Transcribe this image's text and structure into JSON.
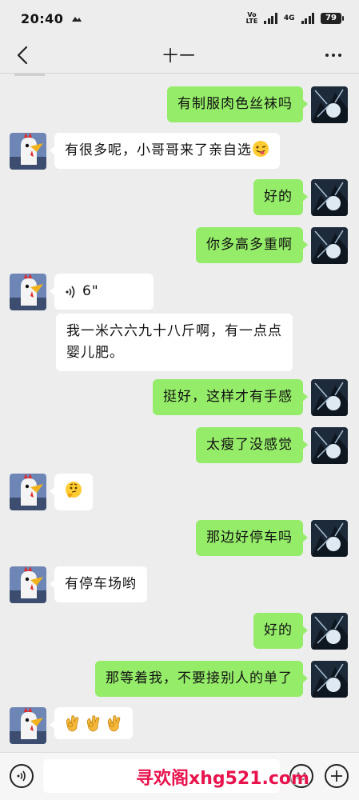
{
  "status_bar": {
    "time": "20:40",
    "net_top": "Vo",
    "net_bottom": "LTE",
    "net2": "4G",
    "battery": "79"
  },
  "nav": {
    "title": "十一",
    "back_icon": "chevron-left-icon",
    "more_icon": "more-dots-icon"
  },
  "messages": [
    {
      "side": "right",
      "text": "有制服肉色丝袜吗"
    },
    {
      "side": "left",
      "text": "有很多呢，小哥哥来了亲自选"
    },
    {
      "side": "right",
      "text": "好的"
    },
    {
      "side": "right",
      "text": "你多高多重啊"
    },
    {
      "side": "left",
      "type": "voice",
      "duration": "6\""
    },
    {
      "side": "left",
      "text_line1": "我一米六六九十八斤啊，有一点点",
      "text_line2": "婴儿肥。"
    },
    {
      "side": "right",
      "text": "挺好，这样才有手感"
    },
    {
      "side": "right",
      "text": "太瘦了没感觉"
    },
    {
      "side": "left",
      "type": "emoji",
      "emoji": "thinking-face"
    },
    {
      "side": "right",
      "text": "那边好停车吗"
    },
    {
      "side": "left",
      "text": "有停车场哟"
    },
    {
      "side": "right",
      "text": "好的"
    },
    {
      "side": "right",
      "text": "那等着我，不要接别人的单了"
    },
    {
      "side": "left",
      "type": "emoji",
      "emoji": "ok-hand x3"
    }
  ],
  "input_bar": {
    "placeholder": "",
    "watermark": "寻欢阁xhg521.com"
  },
  "colors": {
    "background": "#ededed",
    "outgoing_bubble": "#95ec69",
    "incoming_bubble": "#ffffff",
    "watermark": "#e8134d"
  }
}
